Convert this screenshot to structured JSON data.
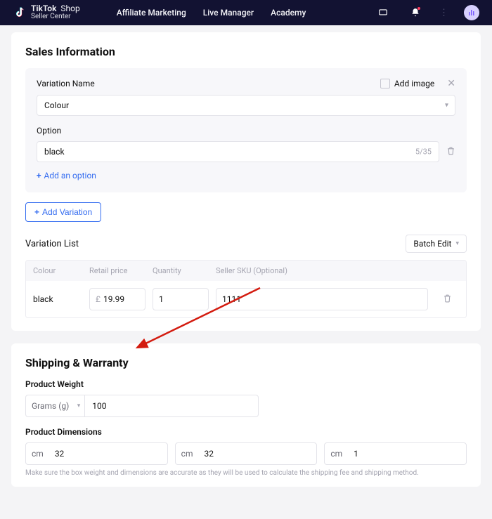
{
  "header": {
    "brand": "TikTok",
    "brand_suffix": "Shop",
    "brand_sub": "Seller Center",
    "nav": [
      "Affiliate Marketing",
      "Live Manager",
      "Academy"
    ]
  },
  "sales": {
    "title": "Sales Information",
    "variation_name_label": "Variation Name",
    "add_image_label": "Add image",
    "variation_name_value": "Colour",
    "option_label": "Option",
    "option_value": "black",
    "option_counter": "5/35",
    "add_option_label": "Add an option",
    "add_variation_label": "Add Variation",
    "variation_list_label": "Variation List",
    "batch_edit_label": "Batch Edit",
    "columns": {
      "colour": "Colour",
      "price": "Retail price",
      "qty": "Quantity",
      "sku": "Seller SKU (Optional)"
    },
    "row": {
      "colour": "black",
      "currency": "£",
      "price": "19.99",
      "qty": "1",
      "sku": "1111"
    }
  },
  "shipping": {
    "title": "Shipping & Warranty",
    "weight_label": "Product Weight",
    "weight_unit": "Grams (g)",
    "weight_value": "100",
    "dimensions_label": "Product Dimensions",
    "dim_unit": "cm",
    "dim1": "32",
    "dim2": "32",
    "dim3": "1",
    "note": "Make sure the box weight and dimensions are accurate as they will be used to calculate the shipping fee and shipping method."
  }
}
